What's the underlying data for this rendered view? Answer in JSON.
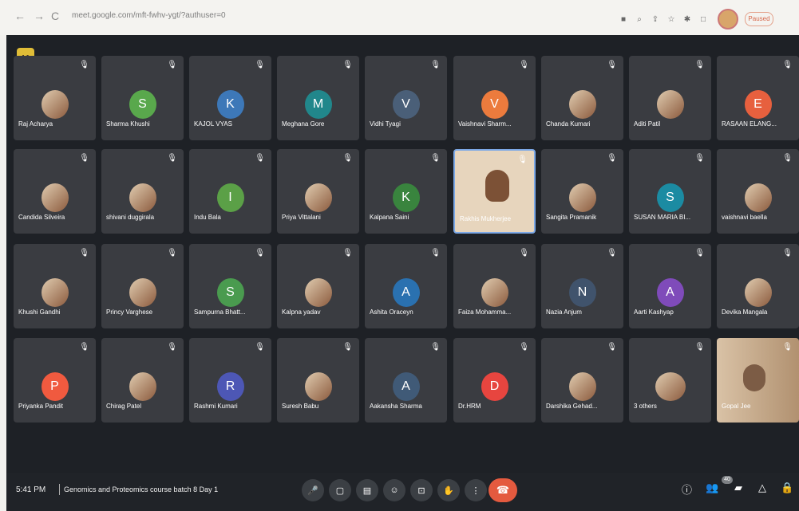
{
  "browser": {
    "back": "←",
    "forward": "→",
    "reload": "C",
    "url": "meet.google.com/mft-fwhv-ygt/?authuser=0",
    "profile_label": "Paused"
  },
  "meeting": {
    "time": "5:41 PM",
    "title": "Genomics and Proteomics course batch 8 Day 1",
    "people_count": "40",
    "logo": "K",
    "colors": {
      "background": "#1e2126",
      "tile": "#3a3c41",
      "end": "#e45a3f",
      "highlight": "#7ca8e6"
    }
  },
  "participants": [
    {
      "name": "Raj Acharya",
      "type": "photo"
    },
    {
      "name": "Sharma Khushi",
      "initial": "S",
      "color": "#59a84c"
    },
    {
      "name": "KAJOL VYAS",
      "initial": "K",
      "color": "#3d78b8"
    },
    {
      "name": "Meghana Gore",
      "initial": "M",
      "color": "#21878b"
    },
    {
      "name": "Vidhi Tyagi",
      "initial": "V",
      "color": "#4a5f78"
    },
    {
      "name": "Vaishnavi Sharm...",
      "initial": "V",
      "color": "#ec7b3d"
    },
    {
      "name": "Chanda Kumari",
      "type": "photo"
    },
    {
      "name": "Aditi Patil",
      "type": "photo"
    },
    {
      "name": "RASAAN ELANG...",
      "initial": "E",
      "color": "#e7603e"
    },
    {
      "name": "Candida Silveira",
      "type": "photo"
    },
    {
      "name": "shivani duggirala",
      "type": "photo"
    },
    {
      "name": "Indu Bala",
      "initial": "I",
      "color": "#5ba047"
    },
    {
      "name": "Priya Vittalani",
      "type": "photo"
    },
    {
      "name": "Kalpana Saini",
      "initial": "K",
      "color": "#39843e"
    },
    {
      "name": "Rakhis Mukherjee",
      "type": "video_presenter"
    },
    {
      "name": "Sangita Pramanik",
      "type": "photo"
    },
    {
      "name": "SUSAN MARIA BI...",
      "initial": "S",
      "color": "#1b8ba2"
    },
    {
      "name": "vaishnavi baella",
      "type": "photo"
    },
    {
      "name": "Khushi Gandhi",
      "type": "photo"
    },
    {
      "name": "Princy Varghese",
      "type": "photo"
    },
    {
      "name": "Sampurna Bhatt...",
      "initial": "S",
      "color": "#4a9b4f"
    },
    {
      "name": "Kalpna yadav",
      "type": "photo"
    },
    {
      "name": "Ashita Oraceyn",
      "initial": "A",
      "color": "#2a71b0"
    },
    {
      "name": "Faiza Mohamma...",
      "type": "photo"
    },
    {
      "name": "Nazia Anjum",
      "initial": "N",
      "color": "#40536c"
    },
    {
      "name": "Aarti Kashyap",
      "initial": "A",
      "color": "#7f4bba"
    },
    {
      "name": "Devika Mangala",
      "type": "photo"
    },
    {
      "name": "Priyanka Pandit",
      "initial": "P",
      "color": "#f05a3f"
    },
    {
      "name": "Chirag Patel",
      "type": "photo"
    },
    {
      "name": "Rashmi Kumari",
      "initial": "R",
      "color": "#4d57b5"
    },
    {
      "name": "Suresh Babu",
      "type": "photo"
    },
    {
      "name": "Aakansha Sharma",
      "initial": "A",
      "color": "#405a77"
    },
    {
      "name": "Dr.HRM",
      "initial": "D",
      "color": "#e7453f"
    },
    {
      "name": "Darshika Gehad...",
      "type": "photo"
    },
    {
      "name": "3 others",
      "type": "others"
    },
    {
      "name": "Gopal Jee",
      "type": "video"
    }
  ],
  "controls": {
    "mic": "mic-icon",
    "camera": "camera-icon",
    "captions": "captions-icon",
    "emoji": "emoji-icon",
    "present": "present-icon",
    "hand": "raise-hand-icon",
    "more": "more-vert-icon",
    "end": "end-call-icon",
    "info": "info-icon",
    "people": "people-icon",
    "chat": "chat-icon",
    "activities": "activities-icon",
    "host": "host-controls-icon"
  }
}
